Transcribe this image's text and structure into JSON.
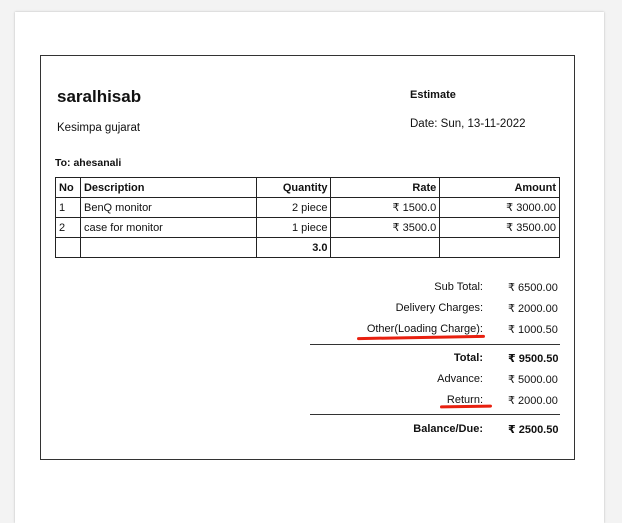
{
  "company": {
    "name": "saralhisab",
    "address": "Kesimpa gujarat"
  },
  "document": {
    "type": "Estimate",
    "date": "Date: Sun, 13-11-2022"
  },
  "customer": {
    "to": "To: ahesanali"
  },
  "table": {
    "headers": {
      "no": "No",
      "description": "Description",
      "quantity": "Quantity",
      "rate": "Rate",
      "amount": "Amount"
    },
    "rows": [
      {
        "no": "1",
        "description": "BenQ monitor",
        "quantity": "2 piece",
        "rate": "₹ 1500.0",
        "amount": "₹ 3000.00"
      },
      {
        "no": "2",
        "description": "case for monitor",
        "quantity": "1 piece",
        "rate": "₹ 3500.0",
        "amount": "₹ 3500.00"
      }
    ],
    "total_quantity": "3.0"
  },
  "summary": {
    "sub_total_label": "Sub Total:",
    "sub_total_value": "₹ 6500.00",
    "delivery_label": "Delivery Charges:",
    "delivery_value": "₹ 2000.00",
    "other_label": "Other(Loading Charge):",
    "other_value": "₹ 1000.50",
    "total_label": "Total:",
    "total_value": "₹ 9500.50",
    "advance_label": "Advance:",
    "advance_value": "₹ 5000.00",
    "return_label": "Return:",
    "return_value": "₹ 2000.00",
    "balance_label": "Balance/Due:",
    "balance_value": "₹ 2500.50"
  },
  "colors": {
    "annotation_underline": "#e8200f",
    "border": "#333333"
  }
}
